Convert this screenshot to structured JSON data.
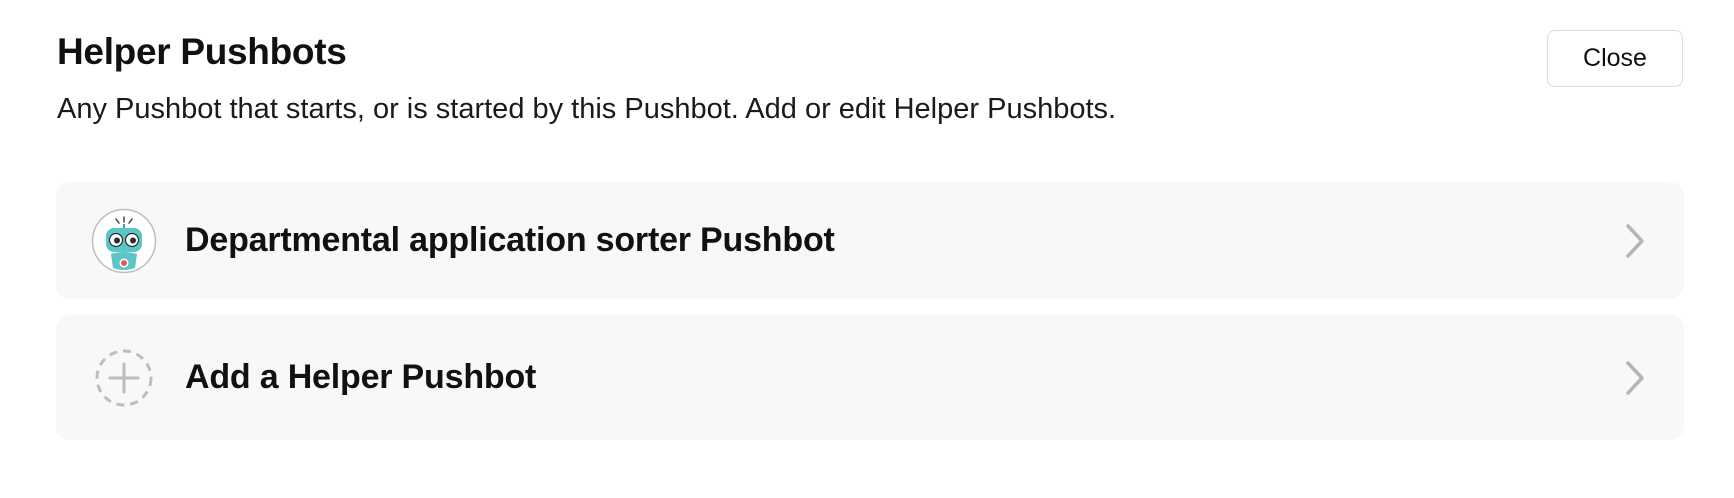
{
  "header": {
    "title": "Helper Pushbots",
    "subtitle": "Any Pushbot that starts, or is started by this Pushbot. Add or edit Helper Pushbots.",
    "close_label": "Close"
  },
  "items": [
    {
      "label": "Departmental application sorter Pushbot",
      "icon": "robot-avatar-icon",
      "chevron": "chevron-right-icon"
    },
    {
      "label": "Add a Helper Pushbot",
      "icon": "add-circle-dashed-icon",
      "chevron": "chevron-right-icon"
    }
  ],
  "colors": {
    "row_background": "#f8f8f8",
    "robot_teal": "#5bc6c6",
    "chevron": "#b5b5b5"
  }
}
